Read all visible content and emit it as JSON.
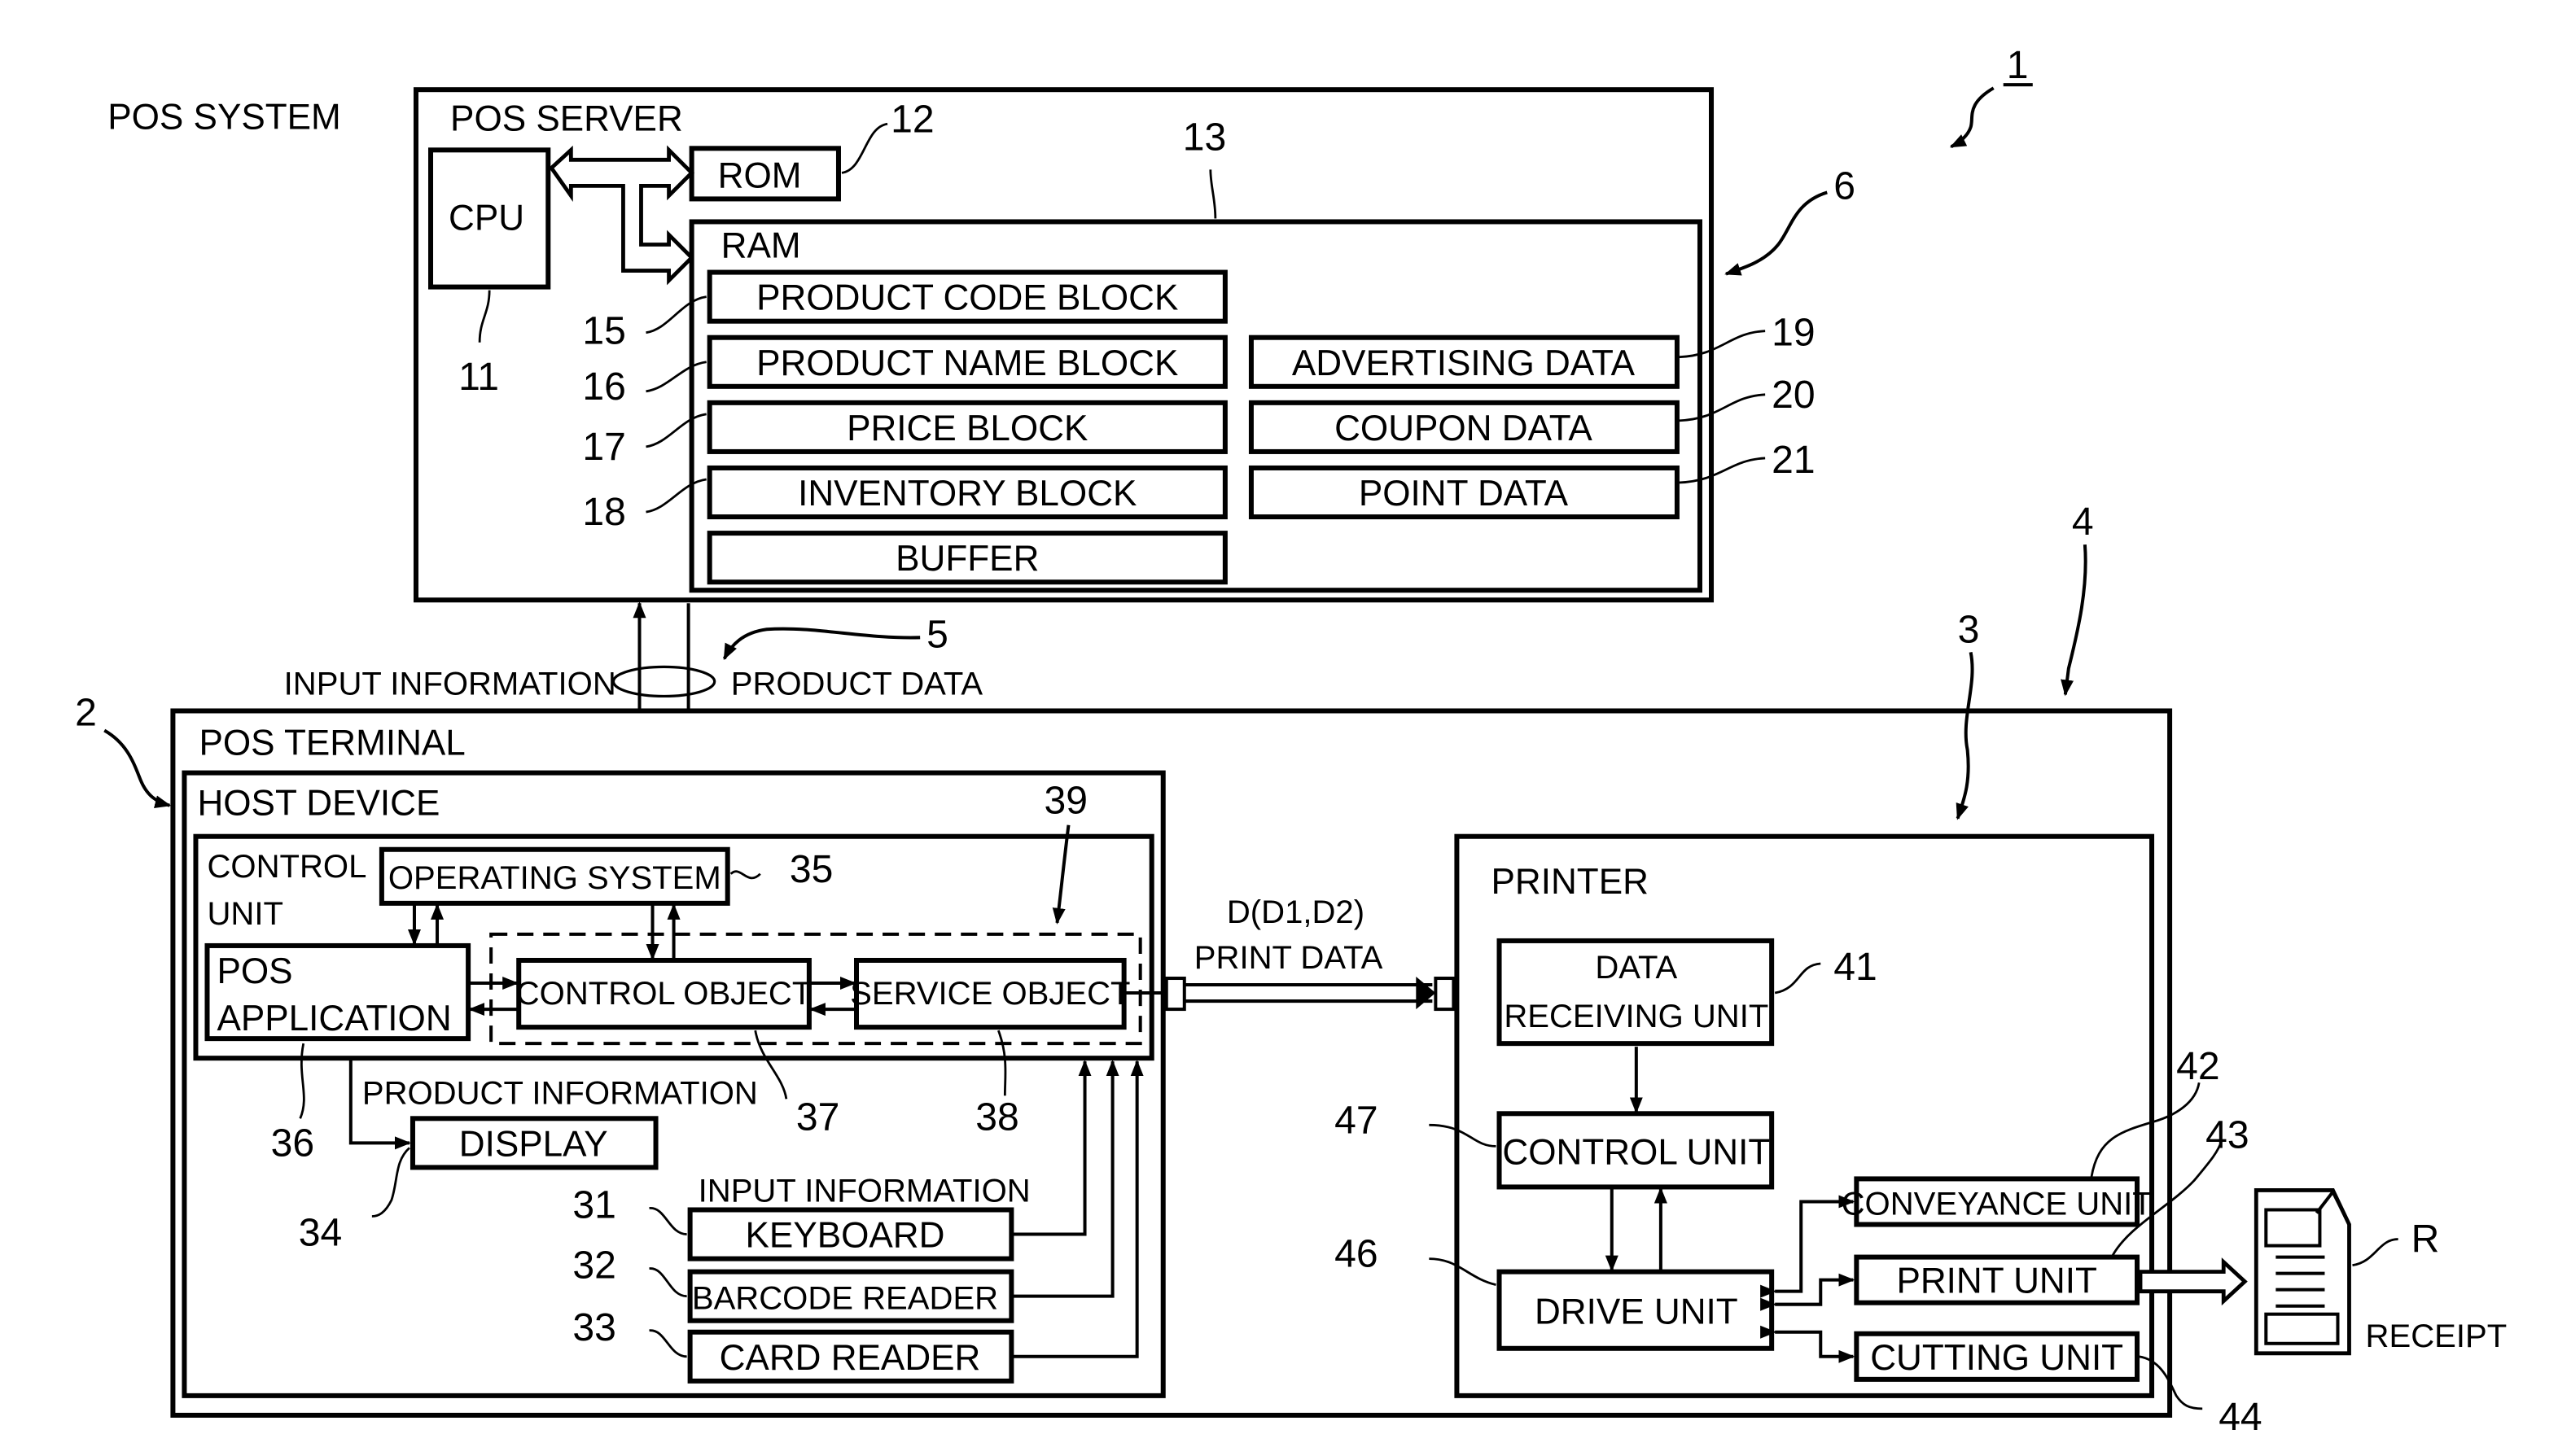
{
  "figure": {
    "system_label": "POS SYSTEM",
    "system_ref": "1",
    "server": {
      "title": "POS SERVER",
      "ref": "6",
      "cpu": {
        "label": "CPU",
        "ref": "11"
      },
      "rom": {
        "label": "ROM",
        "ref": "12"
      },
      "ram": {
        "label": "RAM",
        "ref": "13",
        "left_blocks": [
          {
            "label": "PRODUCT CODE BLOCK",
            "ref": "15"
          },
          {
            "label": "PRODUCT NAME BLOCK",
            "ref": "16"
          },
          {
            "label": "PRICE BLOCK",
            "ref": "17"
          },
          {
            "label": "INVENTORY BLOCK",
            "ref": "18"
          },
          {
            "label": "BUFFER",
            "ref": ""
          }
        ],
        "right_blocks": [
          {
            "label": "ADVERTISING DATA",
            "ref": "19"
          },
          {
            "label": "COUPON DATA",
            "ref": "20"
          },
          {
            "label": "POINT DATA",
            "ref": "21"
          }
        ]
      }
    },
    "network": {
      "ref": "5",
      "up_label": "INPUT INFORMATION",
      "down_label": "PRODUCT DATA"
    },
    "terminal": {
      "title": "POS TERMINAL",
      "ref": "2",
      "outer_ref": "4",
      "host": {
        "title": "HOST DEVICE",
        "control_unit_label_1": "CONTROL",
        "control_unit_label_2": "UNIT",
        "os": {
          "label": "OPERATING SYSTEM",
          "ref": "35"
        },
        "pos_app": {
          "label_1": "POS",
          "label_2": "APPLICATION",
          "ref": "36"
        },
        "control_object": {
          "label": "CONTROL OBJECT",
          "ref": "37"
        },
        "service_object": {
          "label": "SERVICE OBJECT",
          "ref": "38"
        },
        "driver_group_ref": "39",
        "product_info_label": "PRODUCT INFORMATION",
        "display": {
          "label": "DISPLAY",
          "ref": "34"
        },
        "input_info_label": "INPUT INFORMATION",
        "inputs": [
          {
            "label": "KEYBOARD",
            "ref": "31"
          },
          {
            "label": "BARCODE READER",
            "ref": "32"
          },
          {
            "label": "CARD READER",
            "ref": "33"
          }
        ]
      },
      "print_data_label_1": "D(D1,D2)",
      "print_data_label_2": "PRINT DATA",
      "printer": {
        "title": "PRINTER",
        "ref": "3",
        "data_receiving": {
          "label_1": "DATA",
          "label_2": "RECEIVING UNIT",
          "ref": "41"
        },
        "control_unit": {
          "label": "CONTROL UNIT",
          "ref": "47"
        },
        "drive_unit": {
          "label": "DRIVE UNIT",
          "ref": "46"
        },
        "conveyance_unit": {
          "label": "CONVEYANCE UNIT",
          "ref": "42"
        },
        "print_unit": {
          "label": "PRINT UNIT",
          "ref": "43"
        },
        "cutting_unit": {
          "label": "CUTTING UNIT",
          "ref": "44"
        }
      }
    },
    "receipt": {
      "label": "RECEIPT",
      "ref": "R"
    }
  }
}
